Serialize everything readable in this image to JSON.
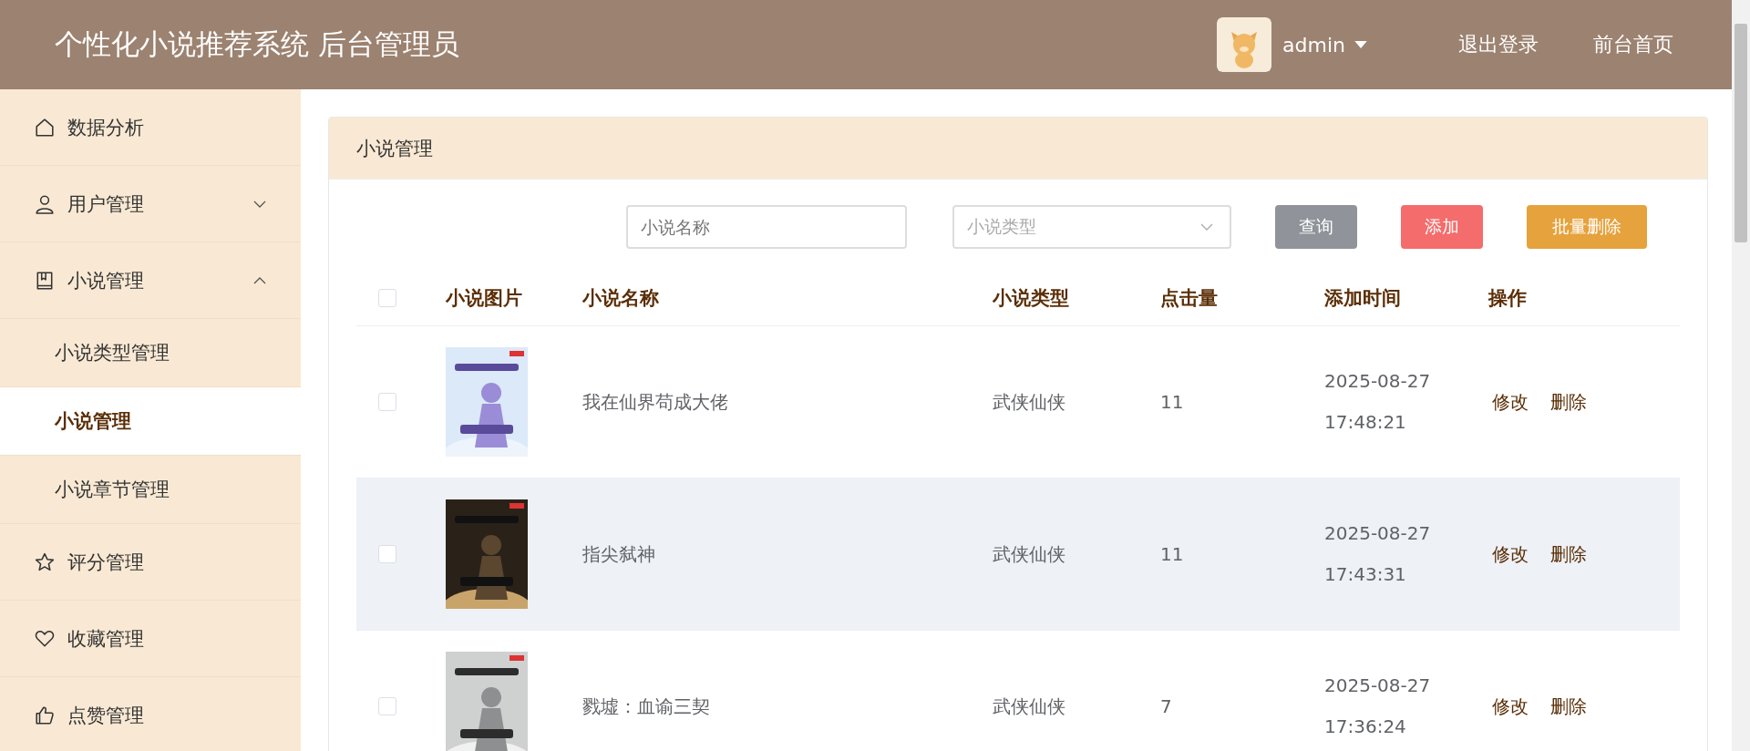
{
  "header": {
    "title": "个性化小说推荐系统 后台管理员",
    "user": "admin",
    "links": [
      "退出登录",
      "前台首页"
    ]
  },
  "sidebar": {
    "items": [
      {
        "label": "数据分析"
      },
      {
        "label": "用户管理",
        "expanded": false
      },
      {
        "label": "小说管理",
        "expanded": true,
        "children": [
          {
            "label": "小说类型管理",
            "selected": false
          },
          {
            "label": "小说管理",
            "selected": true
          },
          {
            "label": "小说章节管理",
            "selected": false
          }
        ]
      },
      {
        "label": "评分管理"
      },
      {
        "label": "收藏管理"
      },
      {
        "label": "点赞管理"
      }
    ]
  },
  "panel": {
    "title": "小说管理",
    "search": {
      "name_placeholder": "小说名称",
      "type_placeholder": "小说类型"
    },
    "buttons": [
      {
        "label": "查询",
        "kind": "query"
      },
      {
        "label": "添加",
        "kind": "add"
      },
      {
        "label": "批量删除",
        "kind": "delete"
      }
    ],
    "table": {
      "all_checked": false,
      "columns": [
        "小说图片",
        "小说名称",
        "小说类型",
        "点击量",
        "添加时间",
        "操作"
      ],
      "rows": [
        {
          "checked": false,
          "hovered": false,
          "name": "我在仙界苟成大佬",
          "type": "武侠仙侠",
          "clicks": "11",
          "date": "2025-08-27",
          "time": "17:48:21",
          "actions": [
            "修改",
            "删除"
          ]
        },
        {
          "checked": false,
          "hovered": true,
          "name": "指尖弑神",
          "type": "武侠仙侠",
          "clicks": "11",
          "date": "2025-08-27",
          "time": "17:43:31",
          "actions": [
            "修改",
            "删除"
          ]
        },
        {
          "checked": false,
          "hovered": false,
          "name": "戮墟：血谕三契",
          "type": "武侠仙侠",
          "clicks": "7",
          "date": "2025-08-27",
          "time": "17:36:24",
          "actions": [
            "修改",
            "删除"
          ]
        }
      ]
    }
  }
}
